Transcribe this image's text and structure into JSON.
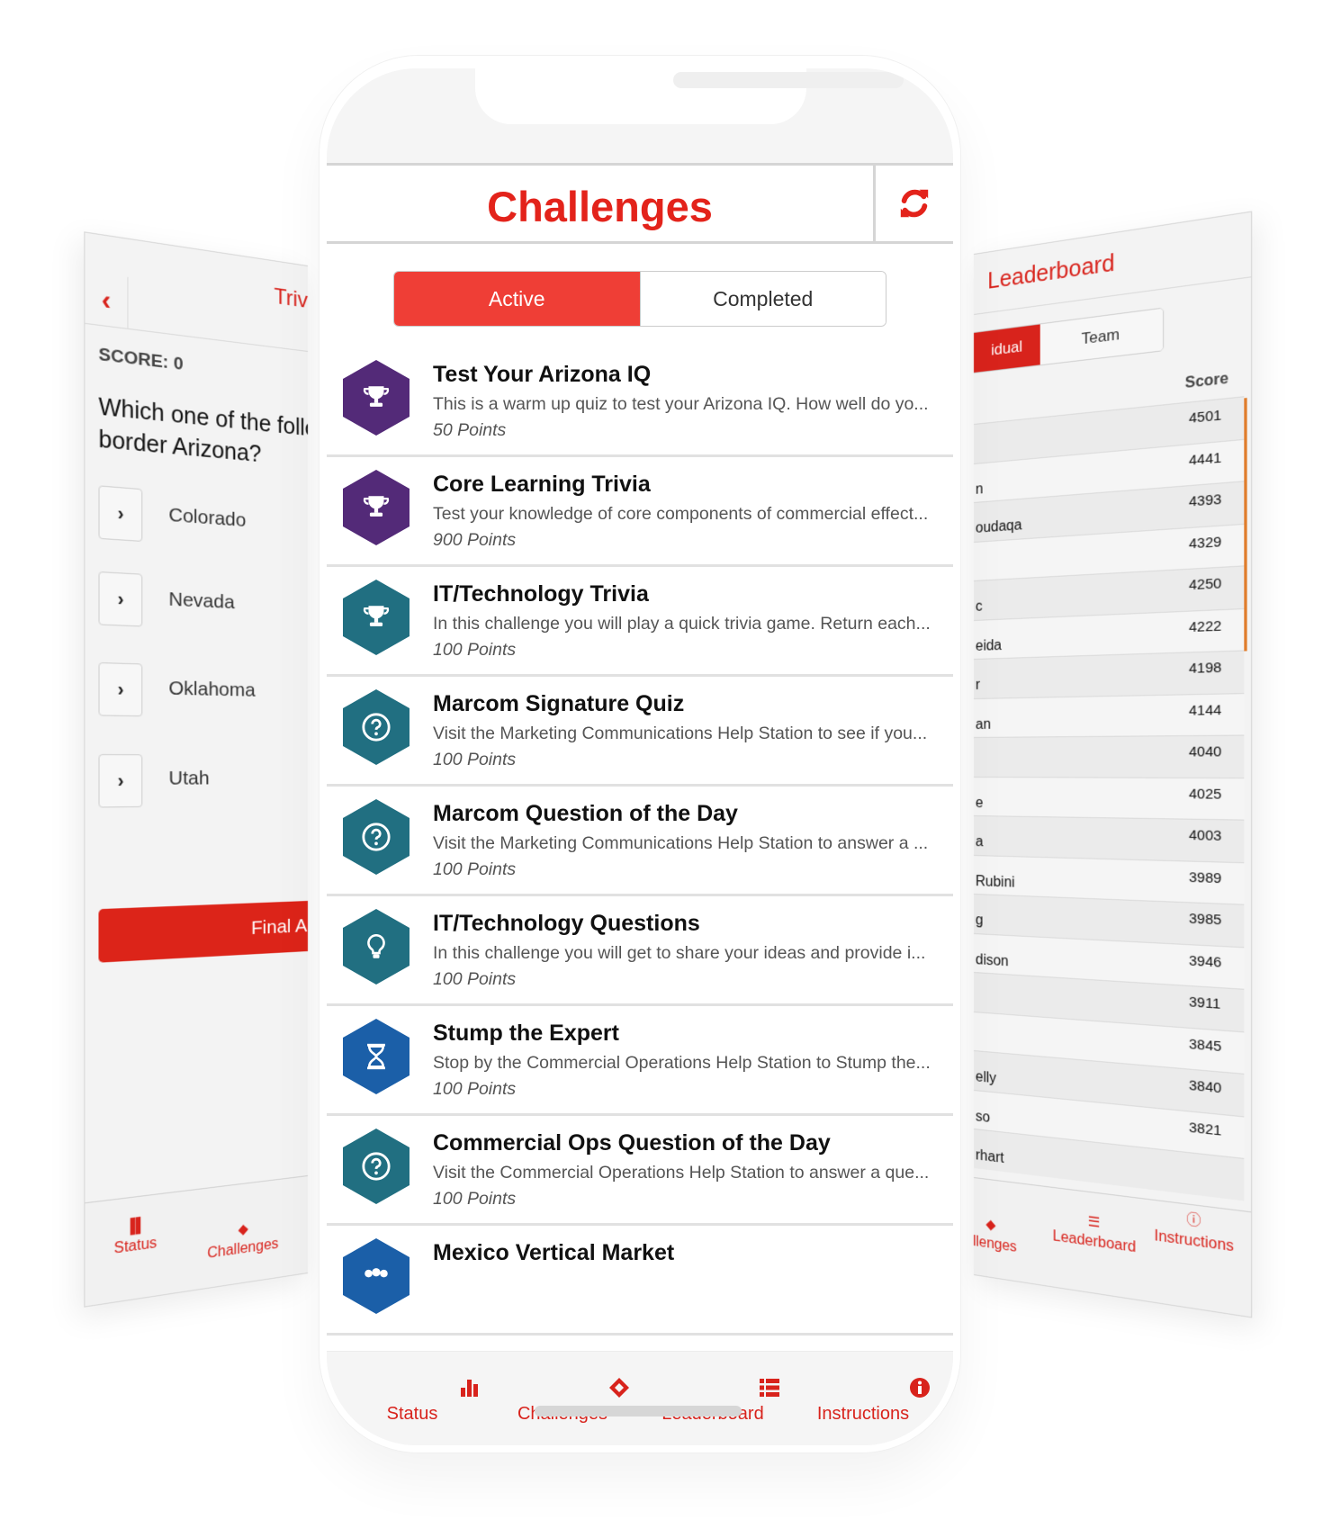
{
  "left_screen": {
    "title": "Trivi",
    "score_label": "SCORE: 0",
    "question_line1": "Which one of the follow",
    "question_line2": "border Arizona?",
    "options": [
      "Colorado",
      "Nevada",
      "Oklahoma",
      "Utah"
    ],
    "final_button": "Final An",
    "nav": [
      {
        "icon": "bar-chart-icon",
        "label": "Status"
      },
      {
        "icon": "ticket-icon",
        "label": "Challenges"
      }
    ]
  },
  "center_screen": {
    "title": "Challenges",
    "refresh_icon": "refresh-icon",
    "tabs": {
      "active": "Active",
      "completed": "Completed",
      "selected": "Active"
    },
    "colors": {
      "accent": "#e3231b",
      "tab_active": "#ef3e36",
      "purple": "#532a78",
      "teal": "#216f81",
      "blue": "#1b5fa8"
    },
    "challenges": [
      {
        "title": "Test Your Arizona IQ",
        "description": "This is a warm up quiz to test your Arizona IQ. How well do yo...",
        "points": "50 Points",
        "icon": "trophy-icon",
        "color": "#532a78"
      },
      {
        "title": "Core Learning Trivia",
        "description": "Test your knowledge of core components of commercial effect...",
        "points": "900 Points",
        "icon": "trophy-icon",
        "color": "#532a78"
      },
      {
        "title": "IT/Technology Trivia",
        "description": "In this challenge you will play a quick trivia game. Return each...",
        "points": "100 Points",
        "icon": "trophy-icon",
        "color": "#216f81"
      },
      {
        "title": "Marcom Signature Quiz",
        "description": "Visit the Marketing Communications Help Station to see if you...",
        "points": "100 Points",
        "icon": "question-circle-icon",
        "color": "#216f81"
      },
      {
        "title": "Marcom Question of the Day",
        "description": "Visit the Marketing Communications Help Station to answer a ...",
        "points": "100 Points",
        "icon": "question-circle-icon",
        "color": "#216f81"
      },
      {
        "title": "IT/Technology Questions",
        "description": "In this challenge you will get to share your ideas and provide i...",
        "points": "100 Points",
        "icon": "lightbulb-icon",
        "color": "#216f81"
      },
      {
        "title": "Stump the Expert",
        "description": "Stop by the Commercial Operations Help Station to Stump the...",
        "points": "100 Points",
        "icon": "hourglass-icon",
        "color": "#1b5fa8"
      },
      {
        "title": "Commercial Ops Question of the Day",
        "description": "Visit the Commercial Operations Help Station to answer a que...",
        "points": "100 Points",
        "icon": "question-circle-icon",
        "color": "#216f81"
      },
      {
        "title": "Mexico Vertical Market",
        "description": "",
        "points": "",
        "icon": "group-icon",
        "color": "#1b5fa8"
      }
    ],
    "nav": [
      {
        "icon": "bar-chart-icon",
        "label": "Status"
      },
      {
        "icon": "ticket-icon",
        "label": "Challenges"
      },
      {
        "icon": "list-icon",
        "label": "Leaderboard"
      },
      {
        "icon": "info-circle-icon",
        "label": "Instructions"
      }
    ]
  },
  "right_screen": {
    "title": "Leaderboard",
    "tabs": {
      "individual": "idual",
      "team": "Team",
      "selected": "Individual"
    },
    "column_score": "Score",
    "rows": [
      {
        "name": "",
        "score": "4501"
      },
      {
        "name": "n",
        "score": "4441"
      },
      {
        "name": "oudaqa",
        "score": "4393"
      },
      {
        "name": "",
        "score": "4329"
      },
      {
        "name": "c",
        "score": "4250"
      },
      {
        "name": "eida",
        "score": "4222"
      },
      {
        "name": "r",
        "score": "4198"
      },
      {
        "name": "an",
        "score": "4144"
      },
      {
        "name": "",
        "score": "4040"
      },
      {
        "name": "e",
        "score": "4025"
      },
      {
        "name": "a",
        "score": "4003"
      },
      {
        "name": "Rubini",
        "score": "3989"
      },
      {
        "name": "g",
        "score": "3985"
      },
      {
        "name": "dison",
        "score": "3946"
      },
      {
        "name": "",
        "score": "3911"
      },
      {
        "name": "",
        "score": "3845"
      },
      {
        "name": "elly",
        "score": "3840"
      },
      {
        "name": "so",
        "score": "3821"
      },
      {
        "name": "rhart",
        "score": ""
      }
    ],
    "nav": [
      {
        "icon": "ticket-icon",
        "label": "allenges"
      },
      {
        "icon": "list-icon",
        "label": "Leaderboard"
      },
      {
        "icon": "info-circle-icon",
        "label": "Instructions"
      }
    ]
  }
}
